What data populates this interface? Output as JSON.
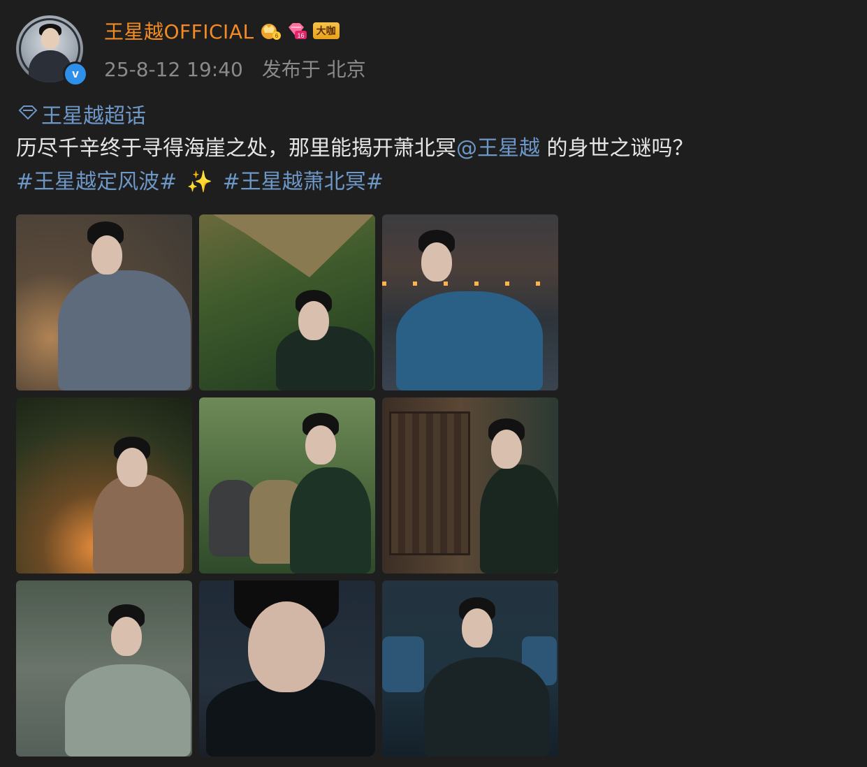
{
  "header": {
    "username": "王星越OFFICIAL",
    "badges": {
      "crown_level": "6",
      "diamond_level": "16",
      "daka_label": "大咖"
    },
    "timestamp": "25-8-12 19:40",
    "location": "发布于 北京",
    "verified_icon": "v"
  },
  "post": {
    "topic": "王星越超话",
    "text_before_mention": "历尽千辛终于寻得海崖之处，那里能揭开萧北冥",
    "mention": "@王星越",
    "text_after_mention": " 的身世之谜吗？",
    "hashtag_1": "#王星越定风波#",
    "sparkle": "✨",
    "hashtag_2": "#王星越萧北冥#"
  },
  "colors": {
    "background": "#1e1e1e",
    "username": "#f28b24",
    "link": "#6d97c7",
    "text": "#e6e6e6",
    "meta": "#8a8a8a",
    "verified": "#2f90ea"
  },
  "photos": [
    {
      "name": "photo-1",
      "desc": "man in grey robe in cave crouching"
    },
    {
      "name": "photo-2",
      "desc": "man in green robe under tarp in forest"
    },
    {
      "name": "photo-3",
      "desc": "man in blue robe with candles behind"
    },
    {
      "name": "photo-4",
      "desc": "man by campfire in forest"
    },
    {
      "name": "photo-5",
      "desc": "man holding cloth sacks in forest"
    },
    {
      "name": "photo-6",
      "desc": "man sitting by wooden carriage"
    },
    {
      "name": "photo-7",
      "desc": "man in light green robe outdoors"
    },
    {
      "name": "photo-8",
      "desc": "close-up portrait in dark robe"
    },
    {
      "name": "photo-9",
      "desc": "man seated in dark blue setting"
    }
  ]
}
